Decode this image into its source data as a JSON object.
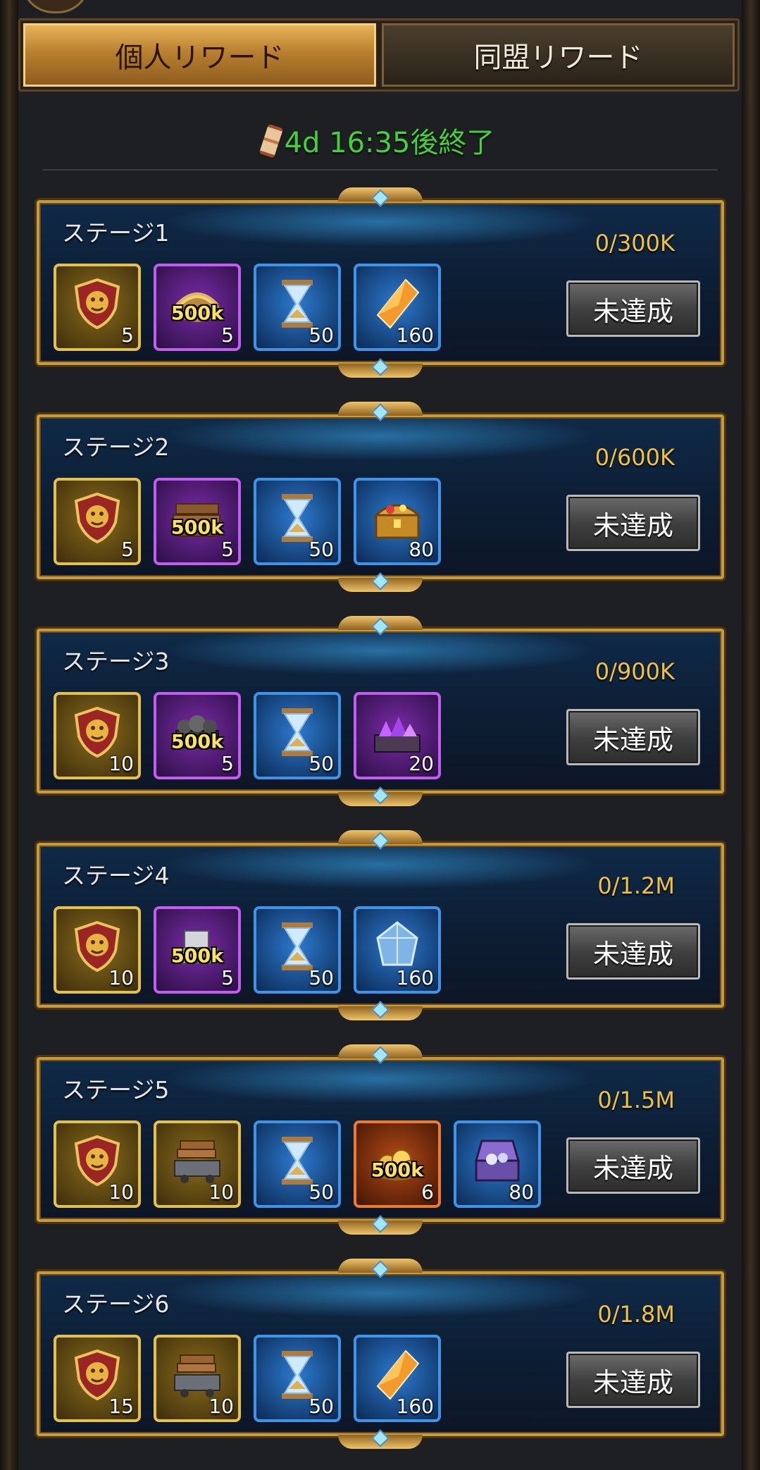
{
  "tabs": [
    {
      "label": "個人リワード",
      "active": true
    },
    {
      "label": "同盟リワード",
      "active": false
    }
  ],
  "timer": {
    "text": "4d 16:35後終了",
    "icon": "hourglass-icon",
    "color": "#44d13a"
  },
  "status_label": "未達成",
  "stages": [
    {
      "title": "ステージ1",
      "progress": "0/300K",
      "status": "未達成",
      "items": [
        {
          "icon": "shield-lion-icon",
          "rarity": "gold",
          "count": "5"
        },
        {
          "icon": "grain-bundle-icon",
          "rarity": "purple",
          "count": "5",
          "badge": "500k"
        },
        {
          "icon": "hourglass-hammer-icon",
          "rarity": "blue",
          "count": "50"
        },
        {
          "icon": "orange-crystal-icon",
          "rarity": "blue",
          "count": "160"
        }
      ]
    },
    {
      "title": "ステージ2",
      "progress": "0/600K",
      "status": "未達成",
      "items": [
        {
          "icon": "shield-lion-icon",
          "rarity": "gold",
          "count": "5"
        },
        {
          "icon": "lumber-pile-icon",
          "rarity": "purple",
          "count": "5",
          "badge": "500k"
        },
        {
          "icon": "hourglass-wheel-icon",
          "rarity": "blue",
          "count": "50"
        },
        {
          "icon": "treasure-chest-icon",
          "rarity": "blue",
          "count": "80"
        }
      ]
    },
    {
      "title": "ステージ3",
      "progress": "0/900K",
      "status": "未達成",
      "items": [
        {
          "icon": "shield-lion-icon",
          "rarity": "gold",
          "count": "10"
        },
        {
          "icon": "ore-cart-icon",
          "rarity": "purple",
          "count": "5",
          "badge": "500k"
        },
        {
          "icon": "hourglass-key-icon",
          "rarity": "blue",
          "count": "50"
        },
        {
          "icon": "purple-gems-icon",
          "rarity": "purple",
          "count": "20"
        }
      ]
    },
    {
      "title": "ステージ4",
      "progress": "0/1.2M",
      "status": "未達成",
      "items": [
        {
          "icon": "shield-lion-icon",
          "rarity": "gold",
          "count": "10"
        },
        {
          "icon": "stone-blocks-icon",
          "rarity": "purple",
          "count": "5",
          "badge": "500k"
        },
        {
          "icon": "hourglass-helmet-icon",
          "rarity": "blue",
          "count": "50"
        },
        {
          "icon": "blue-crystal-icon",
          "rarity": "blue",
          "count": "160"
        }
      ]
    },
    {
      "title": "ステージ5",
      "progress": "0/1.5M",
      "status": "未達成",
      "items": [
        {
          "icon": "shield-lion-icon",
          "rarity": "gold",
          "count": "10"
        },
        {
          "icon": "resource-cart-icon",
          "rarity": "gold",
          "count": "10"
        },
        {
          "icon": "hourglass-icon",
          "rarity": "blue",
          "count": "50"
        },
        {
          "icon": "gold-coins-icon",
          "rarity": "orange",
          "count": "6",
          "badge": "500k"
        },
        {
          "icon": "gem-chest-icon",
          "rarity": "blue",
          "count": "80"
        }
      ]
    },
    {
      "title": "ステージ6",
      "progress": "0/1.8M",
      "status": "未達成",
      "items": [
        {
          "icon": "shield-lion-icon",
          "rarity": "gold",
          "count": "15"
        },
        {
          "icon": "resource-cart-icon",
          "rarity": "gold",
          "count": "10"
        },
        {
          "icon": "hourglass-hammer-icon",
          "rarity": "blue",
          "count": "50"
        },
        {
          "icon": "orange-crystal-icon",
          "rarity": "blue",
          "count": "160"
        }
      ]
    }
  ]
}
